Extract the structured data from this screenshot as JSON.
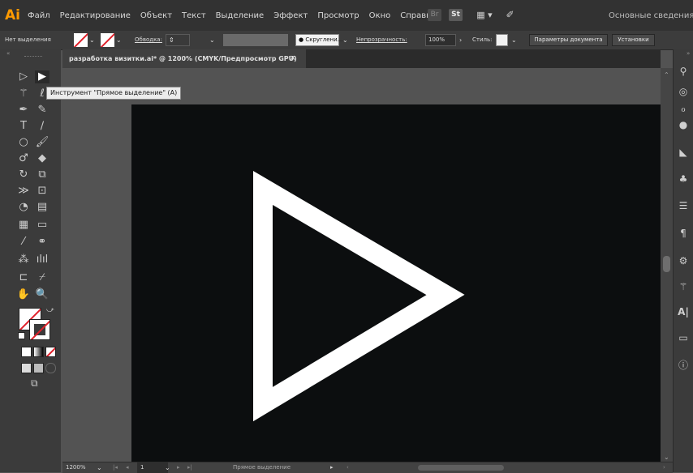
{
  "app": {
    "logo": "Ai",
    "menu": [
      "Файл",
      "Редактирование",
      "Объект",
      "Текст",
      "Выделение",
      "Эффект",
      "Просмотр",
      "Окно",
      "Справка"
    ],
    "workspace": "Основные сведения",
    "icons": {
      "br": "Br",
      "st": "St"
    }
  },
  "control_bar": {
    "selection": "Нет выделения",
    "stroke_label": "Обводка:",
    "profile": "Скруглени...",
    "opacity_label": "Непрозрачность:",
    "opacity_value": "100%",
    "style_label": "Стиль:",
    "doc_settings": "Параметры документа",
    "preferences": "Установки"
  },
  "document": {
    "tab_title": "разработка визитки.ai* @ 1200% (CMYK/Предпросмотр GPU)",
    "tab_close": "×"
  },
  "tooltip": "Инструмент \"Прямое выделение\" (A)",
  "status": {
    "zoom": "1200%",
    "artboard": "1",
    "current_tool": "Прямое выделение"
  },
  "colors": {
    "artboard": "#0c0e0f",
    "triangle_stroke": "#ffffff",
    "accent": "#ff9a00"
  }
}
